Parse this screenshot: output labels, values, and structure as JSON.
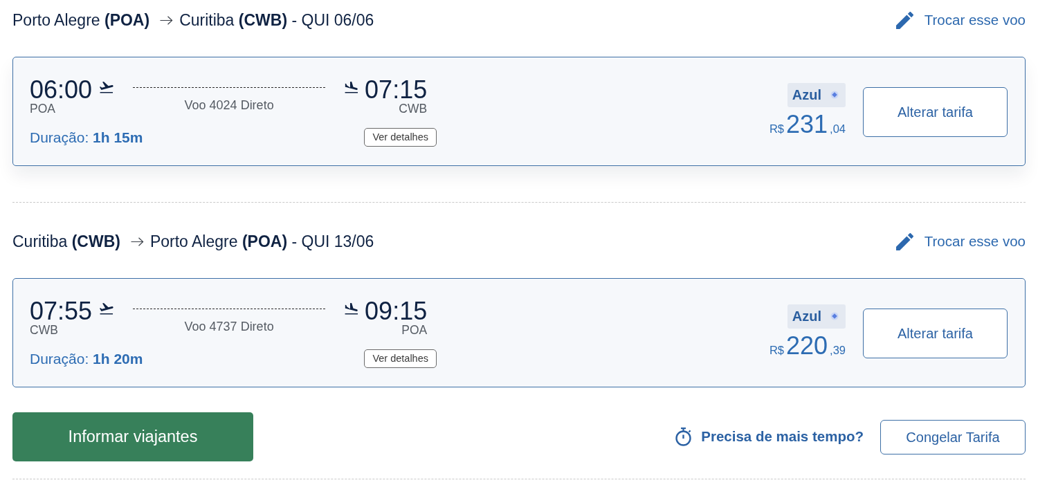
{
  "legs": [
    {
      "origin": "Porto Alegre **(POA)**",
      "destination": "Curitiba **(CWB)** - QUI 06/06",
      "change_link": "Trocar esse voo",
      "elevated": true,
      "flight": {
        "departure_time": "06:00",
        "departure_airport": "POA",
        "flight_info": "Voo 4024 Direto",
        "arrival_time": "07:15",
        "arrival_airport": "CWB",
        "duration": "Duração: **1h 15m**",
        "details_button": "Ver detalhes",
        "airline": "Azul",
        "price": {
          "currency": "R$",
          "integer": "231",
          "cents": ",04"
        },
        "fare_button": "Alterar tarifa"
      }
    },
    {
      "origin": "Curitiba **(CWB)**",
      "destination": "Porto Alegre **(POA)** - QUI 13/06",
      "change_link": "Trocar esse voo",
      "elevated": false,
      "flight": {
        "departure_time": "07:55",
        "departure_airport": "CWB",
        "flight_info": "Voo 4737 Direto",
        "arrival_time": "09:15",
        "arrival_airport": "POA",
        "duration": "Duração: **1h 20m**",
        "details_button": "Ver detalhes",
        "airline": "Azul",
        "price": {
          "currency": "R$",
          "integer": "220",
          "cents": ",39"
        },
        "fare_button": "Alterar tarifa"
      }
    }
  ],
  "footer": {
    "primary_button": "Informar viajantes",
    "help_text": "Precisa de mais tempo?",
    "freeze_button": "Congelar Tarifa"
  }
}
